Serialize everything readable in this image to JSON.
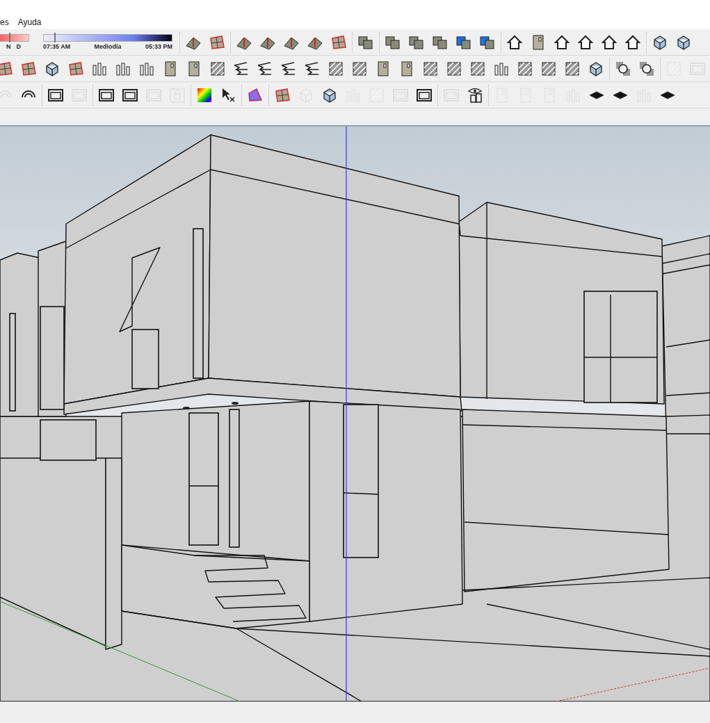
{
  "menu_bar": {
    "items": [
      "es",
      "Ayuda"
    ]
  },
  "shadow_settings": {
    "month_slider": {
      "labels": [
        "N",
        "D"
      ],
      "level": 0.4
    },
    "time_slider": {
      "labels": [
        "07:35 AM",
        "Mediodía",
        "05:33 PM"
      ],
      "level": 0.08
    }
  },
  "toolbars": [
    {
      "groups": [
        {
          "items": [
            {
              "kind": "terrain",
              "disabled": false
            },
            {
              "kind": "mesh",
              "disabled": false
            }
          ]
        },
        {
          "items": [
            {
              "kind": "terrain",
              "disabled": false
            },
            {
              "kind": "terrain",
              "disabled": false
            },
            {
              "kind": "terrain",
              "disabled": false
            },
            {
              "kind": "terrain",
              "disabled": false
            },
            {
              "kind": "mesh",
              "disabled": false
            }
          ]
        },
        {
          "items": [
            {
              "kind": "solid",
              "disabled": false
            }
          ]
        },
        {
          "items": [
            {
              "kind": "solid",
              "disabled": false
            },
            {
              "kind": "solid",
              "disabled": false
            },
            {
              "kind": "solid",
              "disabled": false
            },
            {
              "kind": "solid-face",
              "disabled": false
            },
            {
              "kind": "solid-face",
              "disabled": false
            }
          ]
        },
        {
          "items": [
            {
              "kind": "house",
              "disabled": false
            },
            {
              "kind": "panel",
              "disabled": false
            },
            {
              "kind": "house",
              "disabled": false
            },
            {
              "kind": "house",
              "disabled": false
            },
            {
              "kind": "house",
              "disabled": false
            },
            {
              "kind": "house",
              "disabled": false
            }
          ]
        },
        {
          "items": [
            {
              "kind": "cube",
              "disabled": false
            },
            {
              "kind": "cube",
              "disabled": false
            }
          ]
        }
      ]
    },
    {
      "groups": [
        {
          "items": [
            {
              "kind": "mesh",
              "disabled": false
            },
            {
              "kind": "mesh",
              "disabled": false
            },
            {
              "kind": "cube",
              "disabled": false
            },
            {
              "kind": "mesh",
              "disabled": false
            },
            {
              "kind": "columns",
              "disabled": false
            },
            {
              "kind": "columns",
              "disabled": false
            },
            {
              "kind": "columns",
              "disabled": false
            },
            {
              "kind": "panel",
              "disabled": false
            },
            {
              "kind": "panel",
              "disabled": false
            },
            {
              "kind": "hatch",
              "disabled": false
            },
            {
              "kind": "stairs",
              "disabled": false
            },
            {
              "kind": "stairs",
              "disabled": false
            },
            {
              "kind": "stairs",
              "disabled": false
            },
            {
              "kind": "stairs",
              "disabled": false
            },
            {
              "kind": "hatch",
              "disabled": false
            },
            {
              "kind": "hatch",
              "disabled": false
            },
            {
              "kind": "panel",
              "disabled": false
            },
            {
              "kind": "panel",
              "disabled": false
            },
            {
              "kind": "hatch",
              "disabled": false
            },
            {
              "kind": "hatch",
              "disabled": false
            },
            {
              "kind": "hatch",
              "disabled": false
            },
            {
              "kind": "columns",
              "disabled": false
            },
            {
              "kind": "hatch",
              "disabled": false
            },
            {
              "kind": "hatch",
              "disabled": false
            },
            {
              "kind": "hatch",
              "disabled": false
            },
            {
              "kind": "cube",
              "disabled": false
            }
          ]
        },
        {
          "items": [
            {
              "kind": "sphere",
              "disabled": false
            },
            {
              "kind": "sphere",
              "disabled": false
            }
          ]
        },
        {
          "items": [
            {
              "kind": "hatch",
              "disabled": true
            },
            {
              "kind": "frame",
              "disabled": true
            }
          ]
        }
      ]
    },
    {
      "groups": [
        {
          "items": [
            {
              "kind": "rings",
              "disabled": true
            },
            {
              "kind": "rings",
              "disabled": false
            }
          ]
        },
        {
          "items": [
            {
              "kind": "frame",
              "disabled": false
            },
            {
              "kind": "frame",
              "disabled": true
            }
          ]
        },
        {
          "items": [
            {
              "kind": "frame",
              "disabled": false
            },
            {
              "kind": "frame",
              "disabled": false
            },
            {
              "kind": "frame",
              "disabled": true
            },
            {
              "kind": "lock",
              "disabled": true
            }
          ]
        },
        {
          "items": [
            {
              "kind": "color-grid",
              "disabled": false
            },
            {
              "kind": "cursor",
              "disabled": false
            }
          ]
        },
        {
          "items": [
            {
              "kind": "polygon",
              "disabled": false
            }
          ]
        },
        {
          "items": [
            {
              "kind": "mesh",
              "disabled": false
            },
            {
              "kind": "cube",
              "disabled": true
            },
            {
              "kind": "cube",
              "disabled": false
            },
            {
              "kind": "columns",
              "disabled": true
            },
            {
              "kind": "hatch",
              "disabled": true
            },
            {
              "kind": "frame",
              "disabled": true
            },
            {
              "kind": "frame",
              "disabled": false
            }
          ]
        },
        {
          "items": [
            {
              "kind": "frame",
              "disabled": true
            },
            {
              "kind": "eye",
              "disabled": false
            }
          ]
        },
        {
          "items": [
            {
              "kind": "panel",
              "disabled": true
            },
            {
              "kind": "panel",
              "disabled": true
            },
            {
              "kind": "panel",
              "disabled": true
            },
            {
              "kind": "columns",
              "disabled": true
            },
            {
              "kind": "slab",
              "disabled": false
            },
            {
              "kind": "slab",
              "disabled": false
            },
            {
              "kind": "columns",
              "disabled": true
            },
            {
              "kind": "slab",
              "disabled": false
            }
          ]
        }
      ]
    }
  ]
}
